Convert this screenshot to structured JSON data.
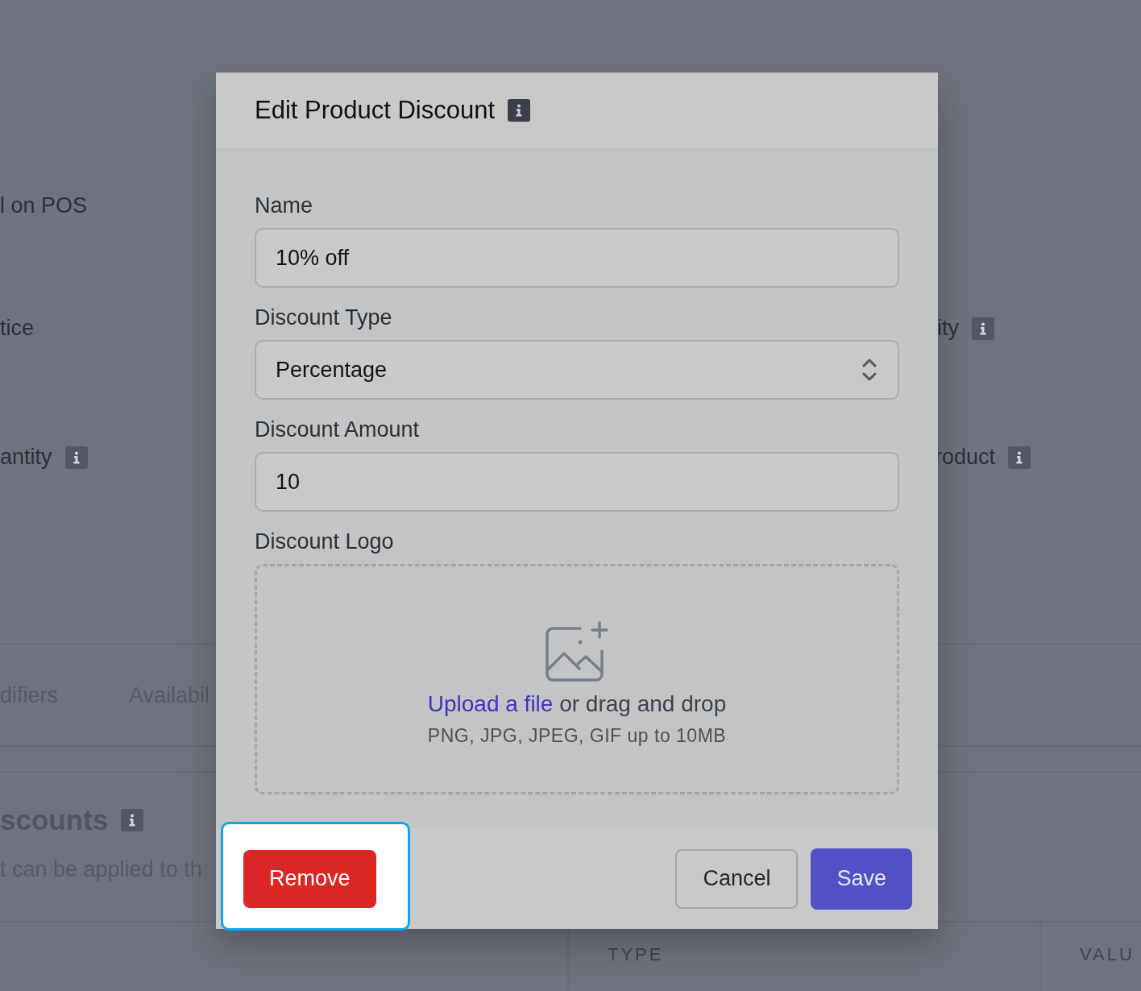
{
  "background": {
    "texts": [
      {
        "kind": "label",
        "text": "l on POS",
        "info": false
      },
      {
        "kind": "label",
        "text": "tice",
        "info": false
      },
      {
        "kind": "label",
        "text": "antity",
        "info": true
      },
      {
        "kind": "label",
        "text": "ity",
        "info": true
      },
      {
        "kind": "label",
        "text": "roduct",
        "info": true
      },
      {
        "kind": "tab",
        "text": "difiers",
        "info": false
      },
      {
        "kind": "tab",
        "text": "Availabil",
        "info": false
      },
      {
        "kind": "heading",
        "text": "scounts",
        "info": true
      },
      {
        "kind": "description",
        "text": "t can be applied to th",
        "info": false
      }
    ],
    "table_headers": [
      "TYPE",
      "VALU"
    ]
  },
  "modal": {
    "title": "Edit Product Discount",
    "fields": [
      {
        "kind": "text",
        "label": "Name",
        "value": "10% off"
      },
      {
        "kind": "select",
        "label": "Discount Type",
        "value": "Percentage"
      },
      {
        "kind": "text",
        "label": "Discount Amount",
        "value": "10"
      },
      {
        "kind": "upload",
        "label": "Discount Logo",
        "link": "Upload a file",
        "text": "or drag and drop",
        "hint": "PNG, JPG, JPEG, GIF up to 10MB"
      }
    ],
    "buttons": [
      {
        "kind": "danger",
        "label": "Remove",
        "highlighted": true
      },
      {
        "kind": "secondary",
        "label": "Cancel",
        "highlighted": false
      },
      {
        "kind": "primary",
        "label": "Save",
        "highlighted": false
      }
    ]
  }
}
